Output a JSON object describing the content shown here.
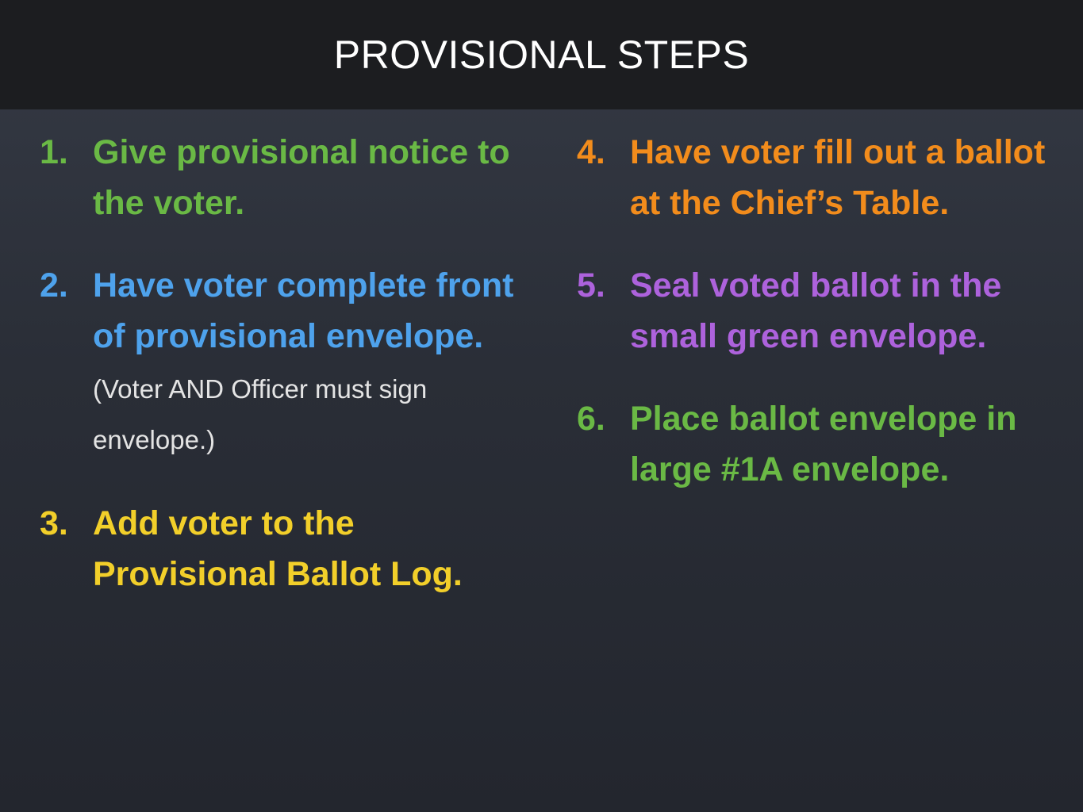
{
  "slide": {
    "title": "PROVISIONAL STEPS"
  },
  "steps": [
    {
      "number": "1.",
      "text": "Give provisional notice to the voter.",
      "color": "#6ab945"
    },
    {
      "number": "2.",
      "text": "Have voter complete front of provisional envelope.",
      "note": "(Voter AND Officer must sign envelope.)",
      "color": "#4ea2ec"
    },
    {
      "number": "3.",
      "text": "Add voter to the Provisional Ballot Log.",
      "color": "#f2cf2a"
    },
    {
      "number": "4.",
      "text": "Have voter fill out a ballot at the Chief’s Table.",
      "color": "#f28c1c"
    },
    {
      "number": "5.",
      "text": "Seal voted ballot in the small green envelope.",
      "color": "#ad62dc"
    },
    {
      "number": "6.",
      "text": "Place ballot envelope in large #1A envelope.",
      "color": "#6ab945"
    }
  ]
}
